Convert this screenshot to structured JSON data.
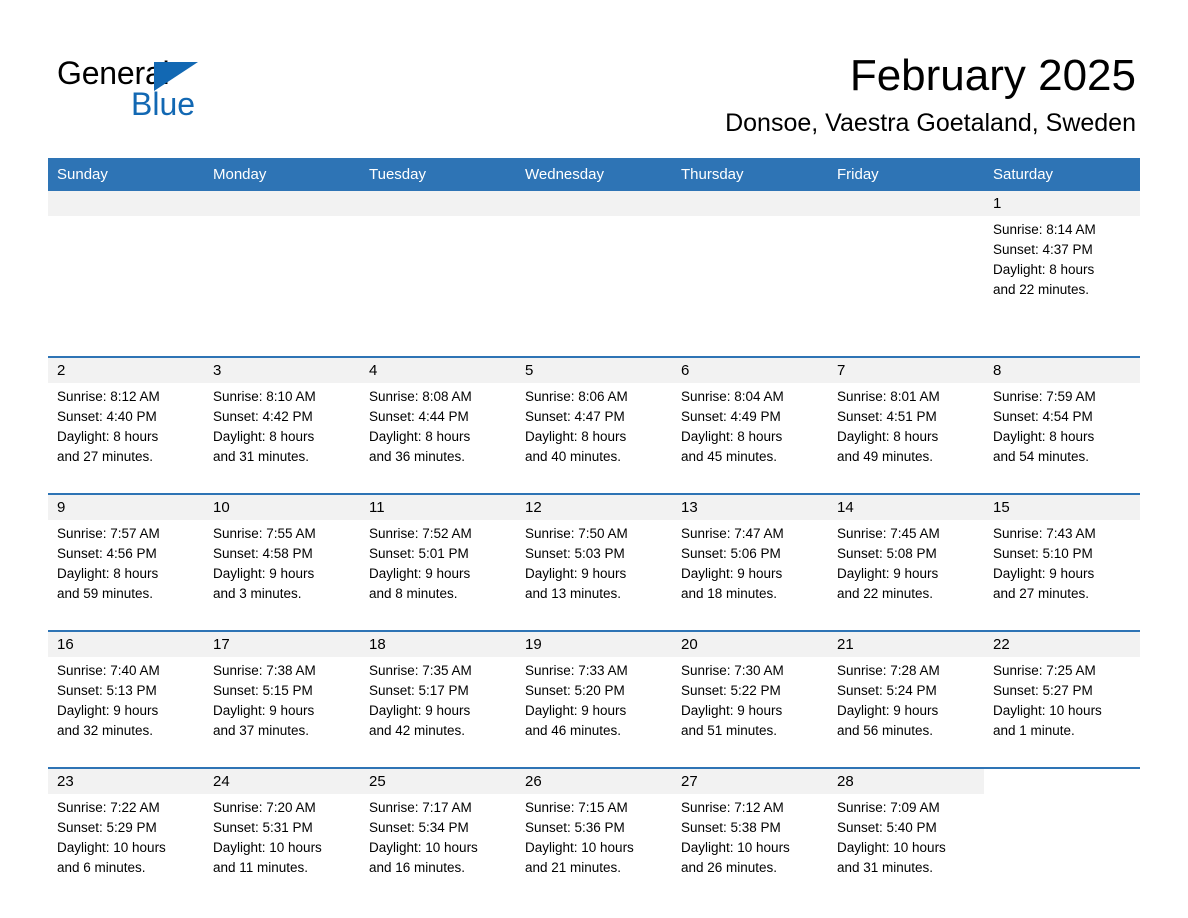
{
  "brand": {
    "name_part1": "General",
    "name_part2": "Blue",
    "accent_color": "#1268b3"
  },
  "header": {
    "month_title": "February 2025",
    "location": "Donsoe, Vaestra Goetaland, Sweden"
  },
  "theme": {
    "header_blue": "#2e74b5",
    "daynum_band": "#f2f2f2",
    "text": "#000000"
  },
  "calendar": {
    "weekday_headers": [
      "Sunday",
      "Monday",
      "Tuesday",
      "Wednesday",
      "Thursday",
      "Friday",
      "Saturday"
    ],
    "weeks": [
      [
        {
          "day": "",
          "empty": true
        },
        {
          "day": "",
          "empty": true
        },
        {
          "day": "",
          "empty": true
        },
        {
          "day": "",
          "empty": true
        },
        {
          "day": "",
          "empty": true
        },
        {
          "day": "",
          "empty": true
        },
        {
          "day": "1",
          "sunrise": "Sunrise: 8:14 AM",
          "sunset": "Sunset: 4:37 PM",
          "daylight1": "Daylight: 8 hours",
          "daylight2": "and 22 minutes."
        }
      ],
      [
        {
          "day": "2",
          "sunrise": "Sunrise: 8:12 AM",
          "sunset": "Sunset: 4:40 PM",
          "daylight1": "Daylight: 8 hours",
          "daylight2": "and 27 minutes."
        },
        {
          "day": "3",
          "sunrise": "Sunrise: 8:10 AM",
          "sunset": "Sunset: 4:42 PM",
          "daylight1": "Daylight: 8 hours",
          "daylight2": "and 31 minutes."
        },
        {
          "day": "4",
          "sunrise": "Sunrise: 8:08 AM",
          "sunset": "Sunset: 4:44 PM",
          "daylight1": "Daylight: 8 hours",
          "daylight2": "and 36 minutes."
        },
        {
          "day": "5",
          "sunrise": "Sunrise: 8:06 AM",
          "sunset": "Sunset: 4:47 PM",
          "daylight1": "Daylight: 8 hours",
          "daylight2": "and 40 minutes."
        },
        {
          "day": "6",
          "sunrise": "Sunrise: 8:04 AM",
          "sunset": "Sunset: 4:49 PM",
          "daylight1": "Daylight: 8 hours",
          "daylight2": "and 45 minutes."
        },
        {
          "day": "7",
          "sunrise": "Sunrise: 8:01 AM",
          "sunset": "Sunset: 4:51 PM",
          "daylight1": "Daylight: 8 hours",
          "daylight2": "and 49 minutes."
        },
        {
          "day": "8",
          "sunrise": "Sunrise: 7:59 AM",
          "sunset": "Sunset: 4:54 PM",
          "daylight1": "Daylight: 8 hours",
          "daylight2": "and 54 minutes."
        }
      ],
      [
        {
          "day": "9",
          "sunrise": "Sunrise: 7:57 AM",
          "sunset": "Sunset: 4:56 PM",
          "daylight1": "Daylight: 8 hours",
          "daylight2": "and 59 minutes."
        },
        {
          "day": "10",
          "sunrise": "Sunrise: 7:55 AM",
          "sunset": "Sunset: 4:58 PM",
          "daylight1": "Daylight: 9 hours",
          "daylight2": "and 3 minutes."
        },
        {
          "day": "11",
          "sunrise": "Sunrise: 7:52 AM",
          "sunset": "Sunset: 5:01 PM",
          "daylight1": "Daylight: 9 hours",
          "daylight2": "and 8 minutes."
        },
        {
          "day": "12",
          "sunrise": "Sunrise: 7:50 AM",
          "sunset": "Sunset: 5:03 PM",
          "daylight1": "Daylight: 9 hours",
          "daylight2": "and 13 minutes."
        },
        {
          "day": "13",
          "sunrise": "Sunrise: 7:47 AM",
          "sunset": "Sunset: 5:06 PM",
          "daylight1": "Daylight: 9 hours",
          "daylight2": "and 18 minutes."
        },
        {
          "day": "14",
          "sunrise": "Sunrise: 7:45 AM",
          "sunset": "Sunset: 5:08 PM",
          "daylight1": "Daylight: 9 hours",
          "daylight2": "and 22 minutes."
        },
        {
          "day": "15",
          "sunrise": "Sunrise: 7:43 AM",
          "sunset": "Sunset: 5:10 PM",
          "daylight1": "Daylight: 9 hours",
          "daylight2": "and 27 minutes."
        }
      ],
      [
        {
          "day": "16",
          "sunrise": "Sunrise: 7:40 AM",
          "sunset": "Sunset: 5:13 PM",
          "daylight1": "Daylight: 9 hours",
          "daylight2": "and 32 minutes."
        },
        {
          "day": "17",
          "sunrise": "Sunrise: 7:38 AM",
          "sunset": "Sunset: 5:15 PM",
          "daylight1": "Daylight: 9 hours",
          "daylight2": "and 37 minutes."
        },
        {
          "day": "18",
          "sunrise": "Sunrise: 7:35 AM",
          "sunset": "Sunset: 5:17 PM",
          "daylight1": "Daylight: 9 hours",
          "daylight2": "and 42 minutes."
        },
        {
          "day": "19",
          "sunrise": "Sunrise: 7:33 AM",
          "sunset": "Sunset: 5:20 PM",
          "daylight1": "Daylight: 9 hours",
          "daylight2": "and 46 minutes."
        },
        {
          "day": "20",
          "sunrise": "Sunrise: 7:30 AM",
          "sunset": "Sunset: 5:22 PM",
          "daylight1": "Daylight: 9 hours",
          "daylight2": "and 51 minutes."
        },
        {
          "day": "21",
          "sunrise": "Sunrise: 7:28 AM",
          "sunset": "Sunset: 5:24 PM",
          "daylight1": "Daylight: 9 hours",
          "daylight2": "and 56 minutes."
        },
        {
          "day": "22",
          "sunrise": "Sunrise: 7:25 AM",
          "sunset": "Sunset: 5:27 PM",
          "daylight1": "Daylight: 10 hours",
          "daylight2": "and 1 minute."
        }
      ],
      [
        {
          "day": "23",
          "sunrise": "Sunrise: 7:22 AM",
          "sunset": "Sunset: 5:29 PM",
          "daylight1": "Daylight: 10 hours",
          "daylight2": "and 6 minutes."
        },
        {
          "day": "24",
          "sunrise": "Sunrise: 7:20 AM",
          "sunset": "Sunset: 5:31 PM",
          "daylight1": "Daylight: 10 hours",
          "daylight2": "and 11 minutes."
        },
        {
          "day": "25",
          "sunrise": "Sunrise: 7:17 AM",
          "sunset": "Sunset: 5:34 PM",
          "daylight1": "Daylight: 10 hours",
          "daylight2": "and 16 minutes."
        },
        {
          "day": "26",
          "sunrise": "Sunrise: 7:15 AM",
          "sunset": "Sunset: 5:36 PM",
          "daylight1": "Daylight: 10 hours",
          "daylight2": "and 21 minutes."
        },
        {
          "day": "27",
          "sunrise": "Sunrise: 7:12 AM",
          "sunset": "Sunset: 5:38 PM",
          "daylight1": "Daylight: 10 hours",
          "daylight2": "and 26 minutes."
        },
        {
          "day": "28",
          "sunrise": "Sunrise: 7:09 AM",
          "sunset": "Sunset: 5:40 PM",
          "daylight1": "Daylight: 10 hours",
          "daylight2": "and 31 minutes."
        },
        {
          "day": "",
          "empty": true,
          "blank_tail": true
        }
      ]
    ]
  }
}
